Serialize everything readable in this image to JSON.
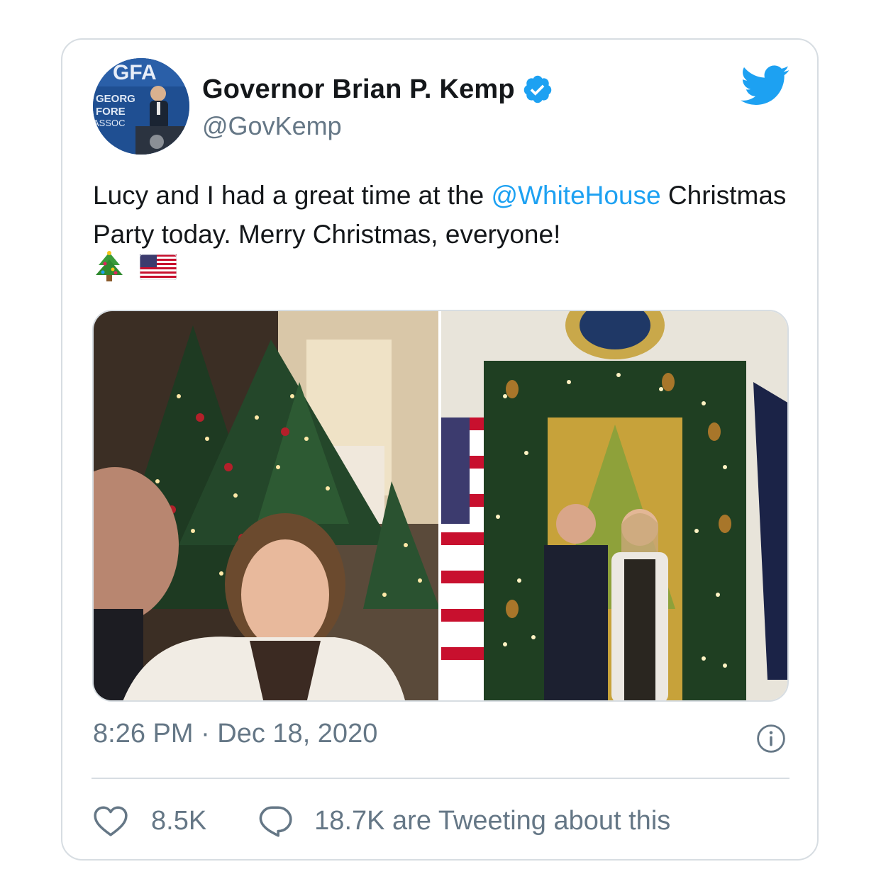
{
  "tweet": {
    "display_name": "Governor Brian P. Kemp",
    "handle": "@GovKemp",
    "text_before": "Lucy and I had a great time at the ",
    "mention": "@WhiteHouse",
    "text_after": " Christmas Party today. Merry Christmas, everyone!",
    "emojis": [
      "🎄",
      "🇺🇸"
    ],
    "timestamp": "8:26 PM · Dec 18, 2020",
    "likes": "8.5K",
    "tweeting_about": "18.7K are Tweeting about this",
    "avatar_text": {
      "top": "GFA",
      "line1": "GEORG",
      "line2": "FORE",
      "line3": "ASSOC"
    }
  },
  "icons": {
    "avatar": "avatar",
    "verified": "verified-badge-icon",
    "logo": "twitter-bird-icon",
    "info": "info-icon",
    "like": "heart-icon",
    "reply": "speech-bubble-icon"
  },
  "colors": {
    "accent": "#1da1f2",
    "text": "#14171a",
    "secondary": "#657786",
    "border": "#d7dde2"
  }
}
